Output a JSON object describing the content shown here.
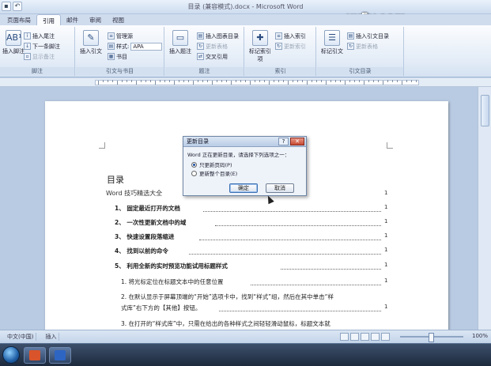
{
  "window": {
    "title": "目录 (兼容模式).docx - Microsoft Word"
  },
  "watermark": "xx5y.com",
  "tabs": [
    {
      "label": "页面布局",
      "active": false
    },
    {
      "label": "引用",
      "active": true
    },
    {
      "label": "邮件",
      "active": false
    },
    {
      "label": "审阅",
      "active": false
    },
    {
      "label": "视图",
      "active": false
    }
  ],
  "ribbon": {
    "footnotes": {
      "label": "脚注",
      "big": "插入脚注",
      "insert_endnote": "插入尾注",
      "next_footnote": "下一条脚注",
      "show_notes": "显示备注"
    },
    "citations": {
      "label": "引文与书目",
      "insert_citation": "插入引文",
      "manage_sources": "管理源",
      "style_label": "样式:",
      "style_value": "APA",
      "bibliography": "书目"
    },
    "captions": {
      "label": "题注",
      "insert_caption": "插入题注",
      "insert_table_of_figures": "插入图表目录",
      "update_table": "更新表格",
      "cross_reference": "交叉引用"
    },
    "index": {
      "label": "索引",
      "mark_entry": "标记索引项",
      "insert_index": "插入索引",
      "update_index": "更新索引"
    },
    "toa": {
      "label": "引文目录",
      "mark_citation": "标记引文",
      "insert_toa": "插入引文目录",
      "update_table": "更新表格"
    }
  },
  "document": {
    "toc_title": "目录",
    "toc_head": "Word 技巧精选大全",
    "entries": [
      {
        "text": "1、 固定最近打开的文档",
        "bold": true
      },
      {
        "text": "2、 一次性更新文档中的域",
        "bold": true
      },
      {
        "text": "3、 快速设置段落缩进",
        "bold": true
      },
      {
        "text": "4、 找到以前的命令",
        "bold": true
      },
      {
        "text": "5、 利用全新的实时预览功能试用标题样式",
        "bold": true
      },
      {
        "text": "1. 将光标定位在标题文本中的任意位置",
        "bold": false
      },
      {
        "text": "2. 在默认显示于屏幕顶端的“开始”选项卡中，找到“样式”组，然后在其中单击“样",
        "bold": false
      },
      {
        "text": "式库”右下方的【其他】按钮。",
        "bold": false
      },
      {
        "text": "3. 在打开的“样式库”中，只需在给出的各种样式之间轻轻滑动鼠标，标题文本就",
        "bold": false
      }
    ],
    "page_num": "1"
  },
  "dialog": {
    "title": "更新目录",
    "message": "Word 正在更新目录，请选择下列选项之一：",
    "option1": "只更新页码(P)",
    "option2": "更新整个目录(E)",
    "selected": 1,
    "ok": "确定",
    "cancel": "取消"
  },
  "statusbar": {
    "items": [
      "中文(中国)",
      "插入"
    ],
    "zoom": "100%"
  }
}
